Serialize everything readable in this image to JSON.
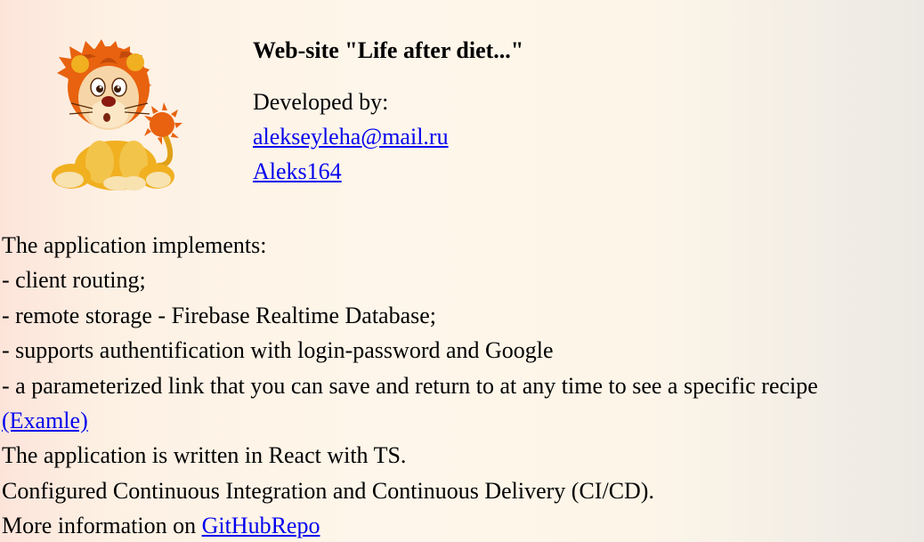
{
  "header": {
    "title": "Web-site \"Life after diet...\"",
    "developed_by_label": "Developed by:",
    "email_link": "alekseyleha@mail.ru",
    "profile_link": "Aleks164"
  },
  "logo": {
    "icon": "lion-cub-mascot-icon",
    "colors": {
      "mane": "#e8620f",
      "body": "#f0b020",
      "face": "#f6d6a8"
    }
  },
  "features": {
    "intro": "The application implements:",
    "items": [
      "- client routing;",
      "- remote storage - Firebase Realtime Database;",
      "- supports authentification with login-password and Google",
      "- a parameterized link that you can save and return to at any time to see a specific recipe"
    ],
    "example_link": "(Examle)"
  },
  "tech_stack": "The application is written in React with TS.",
  "ci_cd": "Configured Continuous Integration and Continuous Delivery (CI/CD).",
  "more_info": {
    "prefix": "More information on ",
    "link": "GitHubRepo"
  },
  "colors": {
    "link": "#0000ee",
    "text": "#000000"
  }
}
